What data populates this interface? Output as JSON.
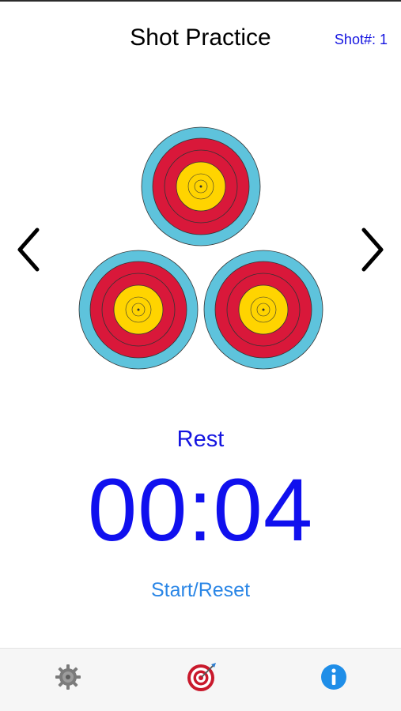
{
  "header": {
    "title": "Shot Practice",
    "shot_counter_label": "Shot#:",
    "shot_counter_value": "1"
  },
  "nav": {
    "prev_icon": "chevron-left-icon",
    "next_icon": "chevron-right-icon"
  },
  "targets": {
    "count": 3,
    "ring_colors": {
      "outer": "#5ec3dc",
      "red": "#d9183a",
      "gold": "#ffd400",
      "line": "#333333"
    }
  },
  "timer": {
    "phase_label": "Rest",
    "time": "00:04",
    "color": "#1010ee"
  },
  "controls": {
    "start_reset_label": "Start/Reset",
    "accent": "#2a86e6"
  },
  "tab_bar": {
    "items": [
      {
        "icon": "gear-icon"
      },
      {
        "icon": "archery-target-icon"
      },
      {
        "icon": "info-icon"
      }
    ]
  }
}
